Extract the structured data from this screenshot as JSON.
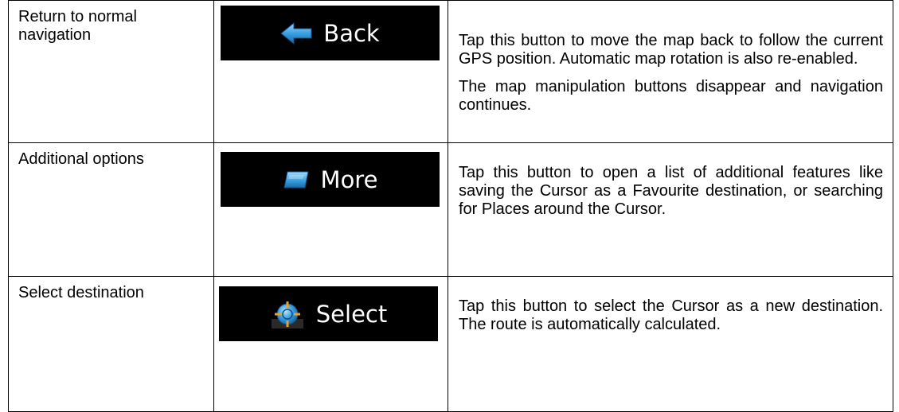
{
  "rows": [
    {
      "label": "Return to normal navigation",
      "button": {
        "label": "Back",
        "icon": "back-arrow-icon"
      },
      "description": [
        "Tap this button to move the map back to follow the current GPS position. Automatic map rotation is also re-enabled.",
        "The map manipulation buttons disappear and navigation continues."
      ]
    },
    {
      "label": "Additional options",
      "button": {
        "label": "More",
        "icon": "more-icon"
      },
      "description": [
        "Tap this button to open a list of additional features like saving the Cursor as a Favourite destination, or searching for Places around the Cursor."
      ]
    },
    {
      "label": "Select destination",
      "button": {
        "label": "Select",
        "icon": "crosshair-icon"
      },
      "description": [
        "Tap this button to select the Cursor as a new destination. The route is automatically calculated."
      ]
    }
  ],
  "colors": {
    "button_bg": "#000000",
    "button_text": "#ffffff",
    "icon_blue": "#3aa0e0"
  }
}
